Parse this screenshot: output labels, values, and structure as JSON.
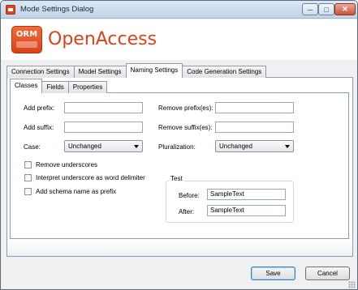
{
  "window": {
    "title": "Mode Settings Dialog",
    "controls": {
      "minimize": "─",
      "maximize": "□",
      "close": "✕"
    }
  },
  "banner": {
    "logo_text": "ORM",
    "brand": "OpenAccess"
  },
  "outer_tabs": [
    {
      "label": "Connection Settings",
      "active": false
    },
    {
      "label": "Model Settings",
      "active": false
    },
    {
      "label": "Naming Settings",
      "active": true
    },
    {
      "label": "Code Generation Settings",
      "active": false
    }
  ],
  "inner_tabs": [
    {
      "label": "Classes",
      "active": true
    },
    {
      "label": "Fields",
      "active": false
    },
    {
      "label": "Properties",
      "active": false
    }
  ],
  "form": {
    "add_prefix": {
      "label": "Add prefix:",
      "value": ""
    },
    "add_suffix": {
      "label": "Add suffix:",
      "value": ""
    },
    "remove_prefixes": {
      "label": "Remove prefix(es):",
      "value": ""
    },
    "remove_suffixes": {
      "label": "Remove suffix(es):",
      "value": ""
    },
    "case": {
      "label": "Case:",
      "value": "Unchanged"
    },
    "pluralization": {
      "label": "Pluralization:",
      "value": "Unchanged"
    },
    "checkboxes": [
      {
        "label": "Remove underscores",
        "checked": false
      },
      {
        "label": "Interpret underscore as word delimiter",
        "checked": false
      },
      {
        "label": "Add schema name as prefix",
        "checked": false
      }
    ],
    "test": {
      "title": "Test",
      "before_label": "Before:",
      "before_value": "SampleText",
      "after_label": "After:",
      "after_value": "SampleText"
    }
  },
  "buttons": {
    "save": "Save",
    "cancel": "Cancel"
  },
  "colors": {
    "brand": "#d8431a",
    "tab_border": "#8d9cb0",
    "titlebar": "#c2d4ea"
  }
}
